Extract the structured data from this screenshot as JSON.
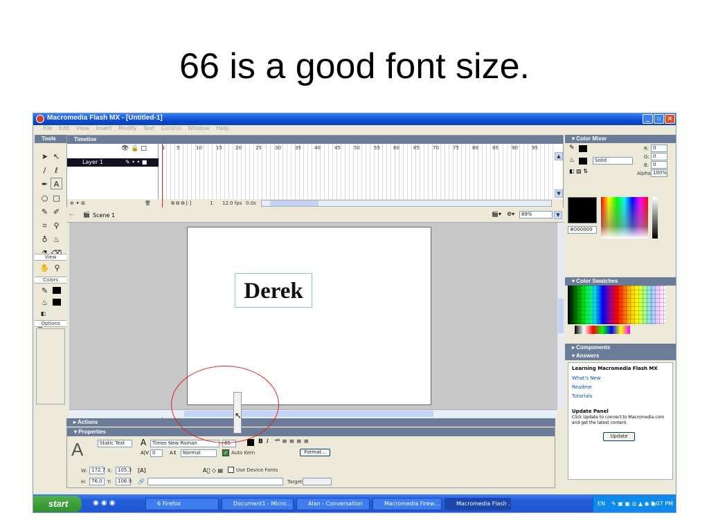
{
  "slide": {
    "title": "66 is a good font size."
  },
  "window": {
    "title": "Macromedia Flash MX - [Untitled-1]",
    "menu": [
      "File",
      "Edit",
      "View",
      "Insert",
      "Modify",
      "Text",
      "Control",
      "Window",
      "Help"
    ]
  },
  "tools": {
    "header": "Tools",
    "view_label": "View",
    "colors_label": "Colors",
    "options_label": "Options"
  },
  "timeline": {
    "header": "Timeline",
    "layer_name": "Layer 1",
    "frame_numbers": [
      "1",
      "5",
      "10",
      "15",
      "20",
      "25",
      "30",
      "35",
      "40",
      "45",
      "50",
      "55",
      "60",
      "65",
      "70",
      "75",
      "80",
      "85",
      "90",
      "95"
    ],
    "current_frame": "1",
    "fps": "12.0 fps",
    "time": "0.0s"
  },
  "scene": {
    "name": "Scene 1",
    "zoom": "89%"
  },
  "stage": {
    "text": "Derek"
  },
  "panels": {
    "actions": "Actions",
    "properties": "Properties",
    "color_mixer": "Color Mixer",
    "color_swatches": "Color Swatches",
    "components": "Components",
    "answers": "Answers"
  },
  "properties": {
    "text_type": "Static Text",
    "font": "Times New Roman",
    "font_size": "65",
    "kerning": "0",
    "char_position": "Normal",
    "auto_kern_label": "Auto Kern",
    "format_button": "Format...",
    "use_device_fonts": "Use Device Fonts",
    "w_label": "W:",
    "w": "172.7",
    "x_label": "X:",
    "x": "105.3",
    "h_label": "H:",
    "h": "76.0",
    "y_label": "Y:",
    "y": "106.9",
    "target_label": "Target:"
  },
  "mixer": {
    "fill_style": "Solid",
    "r_label": "R:",
    "r": "0",
    "g_label": "G:",
    "g": "0",
    "b_label": "B:",
    "b": "0",
    "alpha_label": "Alpha:",
    "alpha": "100%",
    "hex": "#000000"
  },
  "answers": {
    "heading": "Learning Macromedia Flash MX",
    "links": [
      "What's New",
      "Readme",
      "Tutorials"
    ],
    "update_heading": "Update Panel",
    "update_text": "Click Update to connect to Macromedia.com and get the latest content.",
    "update_button": "Update"
  },
  "taskbar": {
    "start": "start",
    "tasks": [
      "6 Firefox",
      "Document1 - Micro...",
      "Alan - Conversation",
      "Macromedia Firew...",
      "Macromedia Flash ..."
    ],
    "lang": "EN",
    "clock": "8:07 PM"
  },
  "colors": {
    "accent": "#0a4bd0",
    "annotation": "#e02020"
  }
}
